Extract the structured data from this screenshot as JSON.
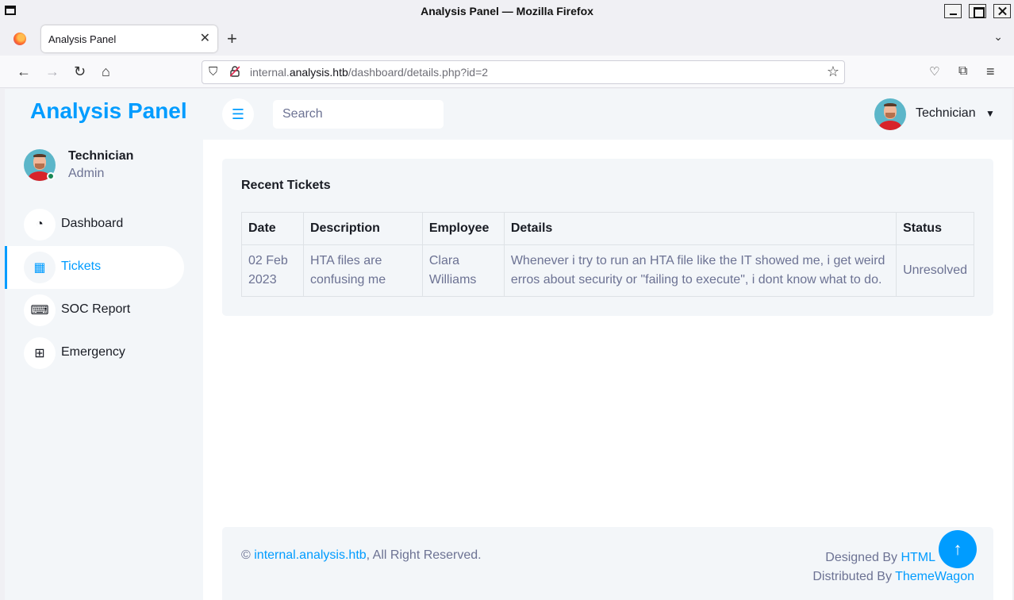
{
  "window": {
    "title": "Analysis Panel — Mozilla Firefox"
  },
  "browser": {
    "tab_title": "Analysis Panel",
    "url_prefix": "internal.",
    "url_host": "analysis.htb",
    "url_path": "/dashboard/details.php?id=2"
  },
  "sidebar": {
    "brand": "Analysis Panel",
    "user_name": "Technician",
    "user_role": "Admin",
    "items": [
      {
        "label": "Dashboard",
        "icon": "dashboard-icon"
      },
      {
        "label": "Tickets",
        "icon": "grid-icon",
        "active": true
      },
      {
        "label": "SOC Report",
        "icon": "keyboard-icon"
      },
      {
        "label": "Emergency",
        "icon": "table-icon"
      }
    ]
  },
  "topbar": {
    "search_placeholder": "Search",
    "user_name": "Technician"
  },
  "tickets": {
    "title": "Recent Tickets",
    "columns": [
      "Date",
      "Description",
      "Employee",
      "Details",
      "Status"
    ],
    "rows": [
      {
        "date": "02 Feb 2023",
        "description": "HTA files are confusing me",
        "employee": "Clara Williams",
        "details": "Whenever i try to run an HTA file like the IT showed me, i get weird erros about security or \"failing to execute\", i dont know what to do.",
        "status": "Unresolved"
      }
    ]
  },
  "footer": {
    "copyright_symbol": "©",
    "site_link": "internal.analysis.htb",
    "rights": ", All Right Reserved.",
    "designed_by": "Designed By ",
    "designer_link": "HTML",
    "distributed_by": "Distributed By ",
    "distributor_link": "ThemeWagon"
  },
  "colors": {
    "accent": "#009cff",
    "sidebar_bg": "#f3f6f9",
    "text_dark": "#191c24",
    "text_muted": "#6c7293"
  }
}
